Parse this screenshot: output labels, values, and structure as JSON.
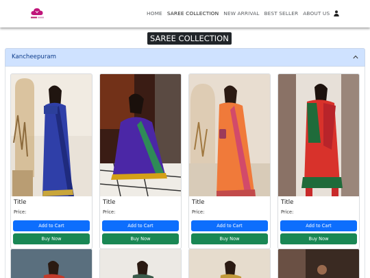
{
  "nav": {
    "links": [
      "HOME",
      "SAREE COLLECTION",
      "NEW ARRIVAL",
      "BEST SELLER",
      "ABOUT US"
    ],
    "active_index": 1,
    "user_icon": "user-icon",
    "logo_icon": "cloud-logo-icon"
  },
  "page": {
    "heading": "SAREE COLLECTION"
  },
  "accordion": {
    "title": "Kancheepuram",
    "toggle_icon": "chevron-up-icon"
  },
  "products": [
    {
      "title": "Title",
      "price_label": "Price:",
      "cart_label": "Add to Cart",
      "buy_label": "Buy Now",
      "saree_color": "#2f3fa8"
    },
    {
      "title": "Title",
      "price_label": "Price:",
      "cart_label": "Add to Cart",
      "buy_label": "Buy Now",
      "saree_color": "#4b27a6"
    },
    {
      "title": "Title",
      "price_label": "Price:",
      "cart_label": "Add to Cart",
      "buy_label": "Buy Now",
      "saree_color": "#f07a3a"
    },
    {
      "title": "Title",
      "price_label": "Price:",
      "cart_label": "Add to Cart",
      "buy_label": "Buy Now",
      "saree_color": "#d8322b"
    }
  ],
  "colors": {
    "primary": "#0d6efd",
    "success": "#198754",
    "accordion_bg": "#cfe2ff",
    "heading_bg": "#212529"
  }
}
